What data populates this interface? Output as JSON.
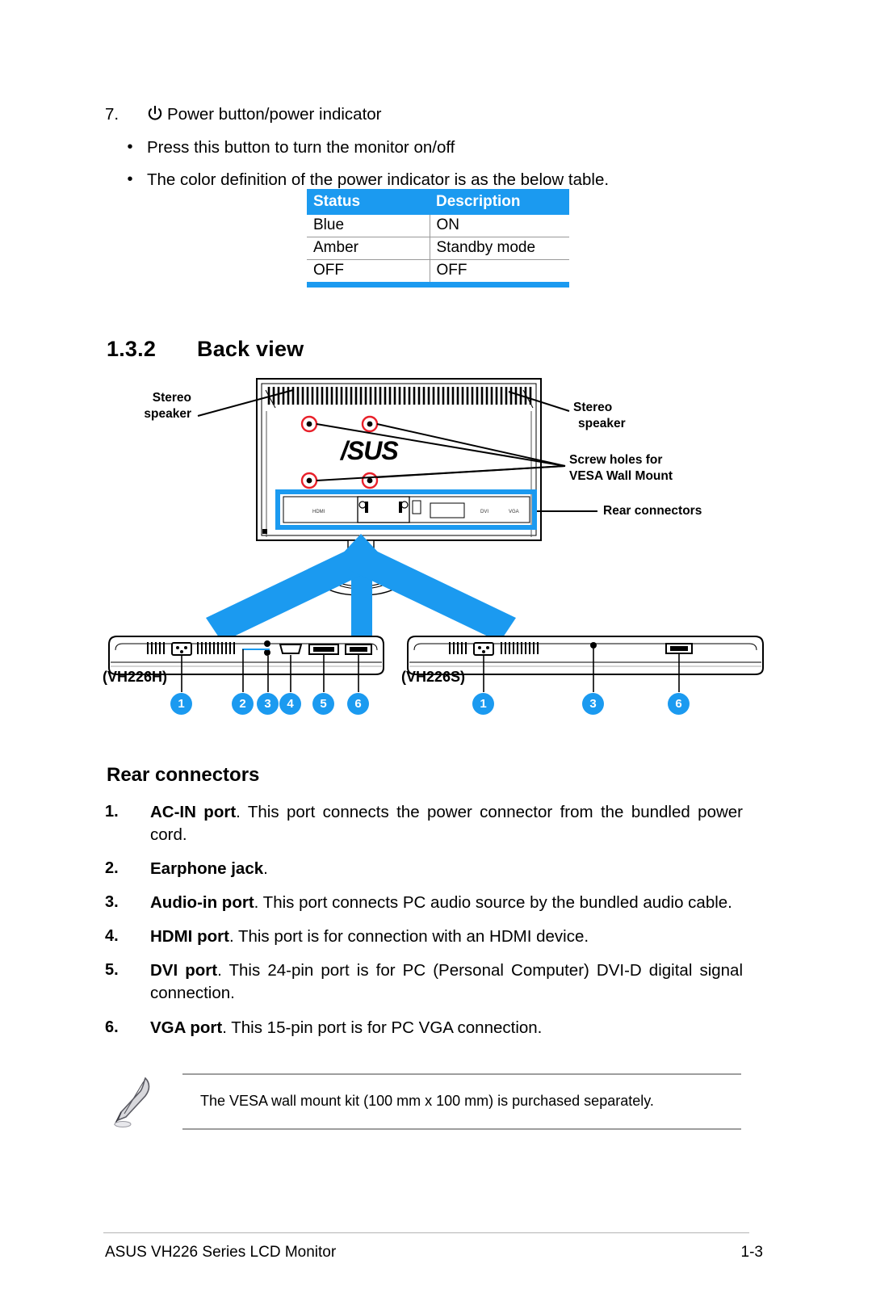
{
  "item7": {
    "number": "7.",
    "icon": "power-icon",
    "title": "Power button/power indicator",
    "bullets": [
      "Press this button to turn the monitor on/off",
      "The color definition of the power indicator is as the below table."
    ]
  },
  "status_table": {
    "accent_color": "#1B9AF0",
    "headers": [
      "Status",
      "Description"
    ],
    "rows": [
      [
        "Blue",
        "ON"
      ],
      [
        "Amber",
        "Standby mode"
      ],
      [
        "OFF",
        "OFF"
      ]
    ]
  },
  "section": {
    "number": "1.3.2",
    "title": "Back view"
  },
  "figure": {
    "labels": {
      "left_speaker": [
        "Stereo",
        "speaker"
      ],
      "right_speaker": [
        "Stereo",
        "speaker"
      ],
      "screw_holes": [
        "Screw holes for",
        "VESA Wall Mount"
      ],
      "rear_connectors": "Rear connectors"
    },
    "brand": "ASUS",
    "port_marks": [
      "HDMI",
      "DVI",
      "VGA"
    ],
    "models": [
      {
        "name": "(VH226H)",
        "callouts": [
          "1",
          "2",
          "3",
          "4",
          "5",
          "6"
        ]
      },
      {
        "name": "(VH226S)",
        "callouts": [
          "1",
          "3",
          "6"
        ]
      }
    ],
    "callout_color": "#1B9AF0"
  },
  "rear_connectors": {
    "heading": "Rear connectors",
    "items": [
      {
        "num": "1.",
        "bold": "AC-IN port",
        "rest": ". This port connects the power connector from the bundled power cord."
      },
      {
        "num": "2.",
        "bold": "Earphone jack",
        "rest": "."
      },
      {
        "num": "3.",
        "bold": "Audio-in port",
        "rest": ". This port connects PC audio source by the bundled audio cable."
      },
      {
        "num": "4.",
        "bold": "HDMI port",
        "rest": ". This port is for connection with an HDMI device."
      },
      {
        "num": "5.",
        "bold": "DVI port",
        "rest": ". This 24-pin port is for PC (Personal Computer) DVI-D digital signal connection."
      },
      {
        "num": "6.",
        "bold": "VGA port",
        "rest": ". This 15-pin port is for PC VGA connection."
      }
    ]
  },
  "note": {
    "icon": "feather-pen-icon",
    "text": "The VESA wall mount kit (100 mm x 100 mm) is purchased separately."
  },
  "footer": {
    "left": "ASUS VH226 Series LCD Monitor",
    "right": "1-3"
  }
}
